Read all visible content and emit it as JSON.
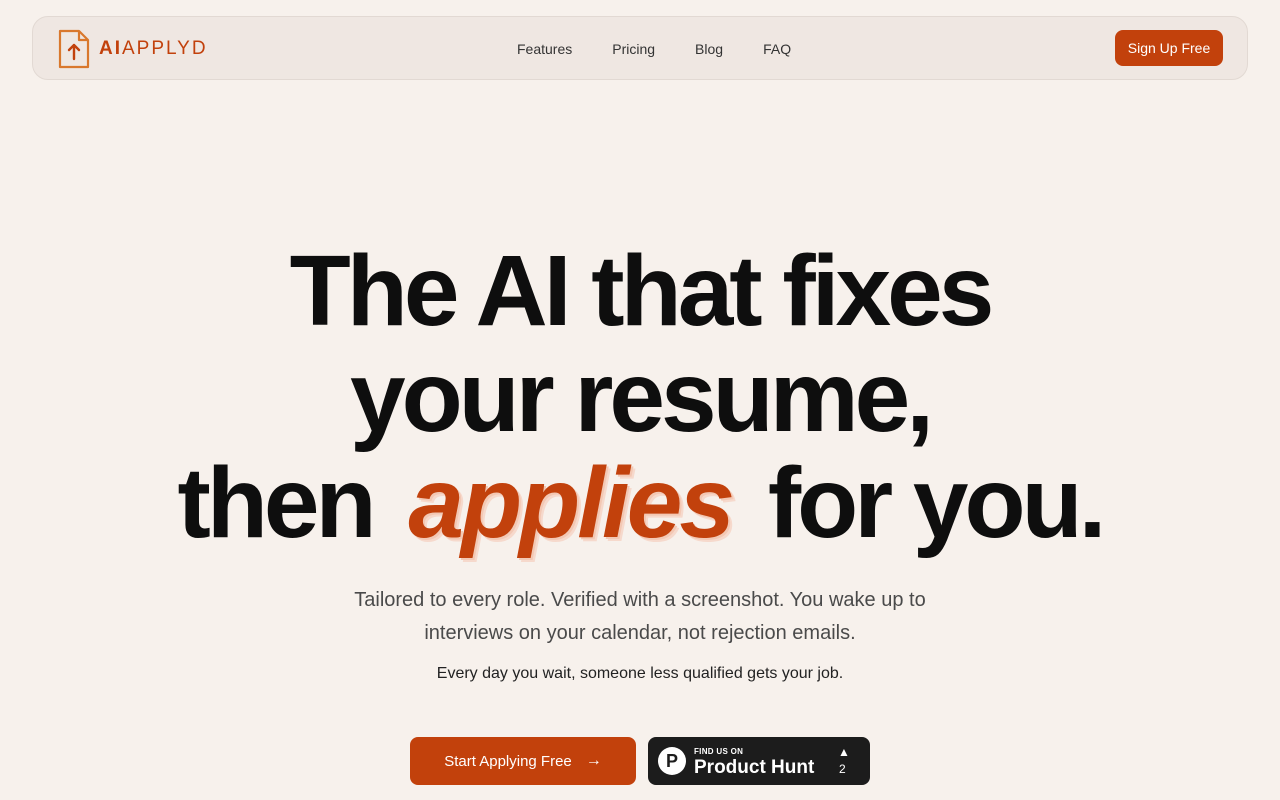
{
  "brand": {
    "logo_ai": "AI",
    "logo_rest": "APPLYD",
    "accent_color": "#c2410c"
  },
  "nav": {
    "links": [
      "Features",
      "Pricing",
      "Blog",
      "FAQ"
    ],
    "signup_label": "Sign Up Free"
  },
  "hero": {
    "line1": "The AI that fixes",
    "line2": "your resume,",
    "line3_before": "then",
    "line3_accent": "applies",
    "line3_after": "for you.",
    "subtitle": "Tailored to every role. Verified with a screenshot. You wake up to interviews on your calendar, not rejection emails.",
    "tagline": "Every day you wait, someone less qualified gets your job."
  },
  "cta": {
    "primary_label": "Start Applying Free",
    "primary_icon": "arrow-right-icon"
  },
  "product_hunt": {
    "small_text": "FIND US ON",
    "big_text": "Product Hunt",
    "logo_letter": "P",
    "upvote_glyph": "▲",
    "upvote_count": "2"
  }
}
